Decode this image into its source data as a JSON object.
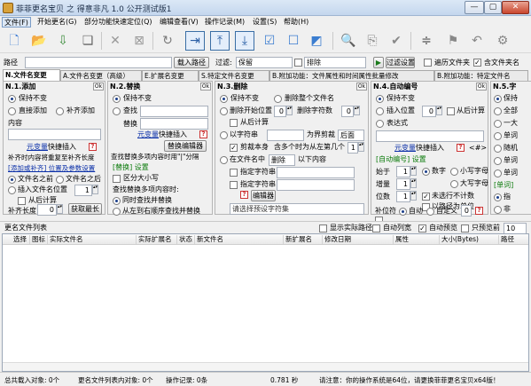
{
  "window": {
    "title": "菲菲更名宝贝 之 得意非凡 1.0 公开测试版1",
    "min": "—",
    "max": "▢",
    "close": "✕"
  },
  "menu": [
    "文件(F)",
    "开始更名(G)",
    "部分功能快速定位(Q)",
    "编辑查看(V)",
    "操作记录(M)",
    "设置(S)",
    "帮助(H)"
  ],
  "pathbar": {
    "path_label": "路径",
    "load_button": "载入路径",
    "filter_label": "过滤:",
    "keep_value": "保留",
    "exclude_value": "排除",
    "filter_settings_button": "过滤设置",
    "traverse_files": "遍历文件夹",
    "include_folder_names": "含文件夹名"
  },
  "tabs": [
    "N.文件名变更",
    "A.文件名变更（高级）",
    "E.扩展名变更",
    "S.特定文件名变更",
    "B.附加功能：文件属性和时间属性批量修改",
    "B.附加功能：特定文件名"
  ],
  "panel1": {
    "title": "N.1.添加",
    "keep": "保持不变",
    "prepend": "直接添加",
    "pad_add": "补齐添加",
    "content_label": "内容",
    "var_link": "元变量",
    "quick_insert": "快捷插入",
    "note": "补齐时内容将重复至补齐长度",
    "ref_link": "[添加或补齐] 位置及参数设置",
    "before_name": "文件名之前",
    "after_name": "文件名之后",
    "insert_pos": "插入文件名位置",
    "insert_pos_val": "1",
    "from_end": "从后计算",
    "pad_len_label": "补齐长度",
    "pad_len_val": "0",
    "get_max_button": "获取最长"
  },
  "panel2": {
    "title": "N.2.替换",
    "keep": "保持不变",
    "find": "查找",
    "replace": "替换",
    "var_link": "元变量",
    "quick_insert": "快捷插入",
    "editor_button": "替换编辑器",
    "note": "查找替换多项内容时用\"|\"分隔",
    "settings_link": "[替换] 设置",
    "case": "区分大小写",
    "multi_label": "查找替换多项内容时:",
    "simultaneous": "同时查找并替换",
    "sequential": "从左到右顺序查找并替换"
  },
  "panel3": {
    "title": "N.3.删除",
    "keep": "保持不变",
    "delete_all": "删除整个文件名",
    "delete_start": "删除开始位置",
    "delete_start_val": "0",
    "delete_count": "删除字符数",
    "delete_count_val": "0",
    "from_end": "从后计算",
    "by_string": "以字符串",
    "as_boundary": "为界剪裁",
    "position": "后面",
    "cut_self": "剪裁本身",
    "multi_occ": "含多个时为从左第几个",
    "multi_occ_val": "1",
    "in_name": "在文件名中",
    "delete_action": "删除",
    "following": "以下内容",
    "specific_char": "指定字符串",
    "specific_char2": "指定字符串",
    "editor_button": "编辑器",
    "select_placeholder": "请选择预设字符集"
  },
  "panel4": {
    "title": "N.4.自动编号",
    "keep": "保持不变",
    "insert_pos": "插入位置",
    "insert_pos_val": "0",
    "from_end": "从后计算",
    "expression": "表达式",
    "var_link": "元变量",
    "quick_insert": "快捷插入",
    "code": "<#>",
    "settings_link": "[自动编号] 设置",
    "start_label": "始于",
    "start_val": "1",
    "number": "数字",
    "lower": "小写字母",
    "increment": "增量",
    "increment_val": "1",
    "upper": "大写字母",
    "digits": "位数",
    "digits_val": "1",
    "not_counting": "未选行不计数",
    "by_folder": "以路径为单位",
    "sort": "排除",
    "pad_char": "补位符",
    "auto": "自动",
    "custom": "自定义",
    "custom_val": "0"
  },
  "panel5": {
    "title": "N.5.字",
    "items": [
      "保持",
      "全部",
      "一大",
      "单词",
      "随机",
      "单词",
      "单词"
    ],
    "settings_link": "[单词]",
    "opt1": "指",
    "opt2": "非"
  },
  "listbar": {
    "title": "更名文件列表",
    "show_actual": "显示实际路径",
    "auto_expand": "自动列宽",
    "auto_preview": "自动预览",
    "limit": "只预览前",
    "limit_val": "10"
  },
  "grid_columns": [
    "选择",
    "图标",
    "实际文件名",
    "实际扩展名",
    "状态",
    "新文件名",
    "新扩展名",
    "修改日期",
    "属性",
    "大小(Bytes)",
    "路径"
  ],
  "status": {
    "loaded": "总共载入对象: 0个",
    "list_count": "更名文件列表内对象: 0个",
    "record": "操作记录: 0条",
    "time": "0.781 秒",
    "notice": "请注意：你的操作系统是64位，请更换菲菲更名宝贝x64版！"
  }
}
